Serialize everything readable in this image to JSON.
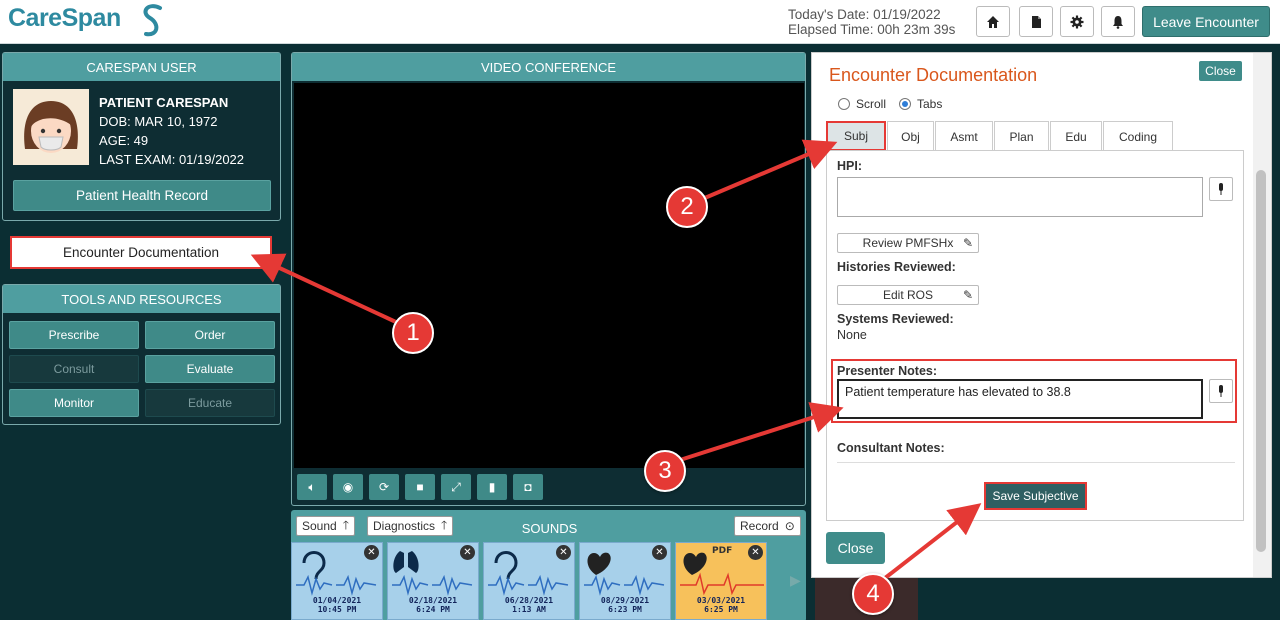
{
  "header": {
    "logo_text": "CareSpan",
    "todays_date": "Today's Date: 01/19/2022",
    "elapsed_time": "Elapsed Time: 00h 23m 39s",
    "icons": [
      "home-icon",
      "document-icon",
      "gear-icon",
      "bell-icon"
    ],
    "leave_label": "Leave Encounter"
  },
  "user_panel": {
    "title": "CARESPAN USER",
    "name": "PATIENT CARESPAN",
    "dob": "DOB: MAR 10, 1972",
    "age": "AGE: 49",
    "last_exam": "LAST EXAM: 01/19/2022",
    "phr_label": "Patient Health Record"
  },
  "encounter_button": "Encounter Documentation",
  "tools": {
    "title": "TOOLS AND RESOURCES",
    "buttons": [
      "Prescribe",
      "Order",
      "Consult",
      "Evaluate",
      "Monitor",
      "Educate"
    ]
  },
  "video": {
    "title": "VIDEO CONFERENCE",
    "controls": [
      "mute-icon",
      "hide-video-icon",
      "refresh-icon",
      "camera-icon",
      "fullscreen-icon",
      "microphone-icon",
      "snapshot-icon"
    ]
  },
  "sounds": {
    "title": "SOUNDS",
    "sound_label": "Sound",
    "diagnostics_label": "Diagnostics",
    "record_label": "Record",
    "cards": [
      {
        "type": "ear",
        "date": "01/04/2021",
        "time": "10:45 PM"
      },
      {
        "type": "lungs",
        "date": "02/18/2021",
        "time": "6:24 PM"
      },
      {
        "type": "ear",
        "date": "06/28/2021",
        "time": "1:13 AM"
      },
      {
        "type": "heart",
        "date": "08/29/2021",
        "time": "6:23 PM"
      },
      {
        "type": "heart-pdf",
        "badge": "PDF",
        "date": "03/03/2021",
        "time": "6:25 PM"
      }
    ]
  },
  "doc": {
    "title": "Encounter Documentation",
    "close_small": "Close",
    "radio_scroll": "Scroll",
    "radio_tabs": "Tabs",
    "tabs": [
      "Subj",
      "Obj",
      "Asmt",
      "Plan",
      "Edu",
      "Coding"
    ],
    "hpi_label": "HPI:",
    "review_pmfshx": "Review PMFSHx",
    "histories_reviewed": "Histories Reviewed:",
    "edit_ros": "Edit ROS",
    "systems_reviewed": "Systems Reviewed:",
    "systems_value": "None",
    "presenter_label": "Presenter Notes:",
    "presenter_value": "Patient temperature has elevated to 38.8",
    "consultant_label": "Consultant Notes:",
    "save_label": "Save Subjective",
    "close_label": "Close"
  },
  "callouts": [
    "1",
    "2",
    "3",
    "4"
  ],
  "colors": {
    "accent": "#3f8c8a",
    "highlight": "#e53935",
    "title": "#d9571c",
    "background": "#0b2e33"
  }
}
